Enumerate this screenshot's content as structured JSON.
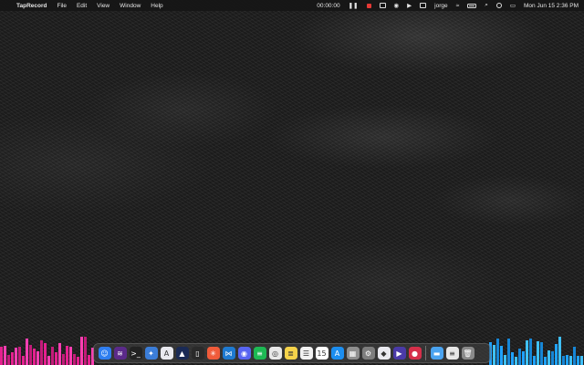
{
  "menubar": {
    "app_name": "TapRecord",
    "menus": [
      "File",
      "Edit",
      "View",
      "Window",
      "Help"
    ],
    "timer": "00:00:00",
    "user": "jorge",
    "datetime": "Mon Jun 15  2:36 PM",
    "record_color": "#e53935"
  },
  "dock": {
    "apps": [
      {
        "name": "finder",
        "glyph": "☺",
        "bg": "#2f7ef0"
      },
      {
        "name": "wave-app",
        "glyph": "≋",
        "bg": "#5b2a8a"
      },
      {
        "name": "terminal",
        "glyph": ">_",
        "bg": "#222222"
      },
      {
        "name": "xcode-like",
        "glyph": "✦",
        "bg": "#3b7dd8"
      },
      {
        "name": "arc",
        "glyph": "A",
        "bg": "#e9e9ef"
      },
      {
        "name": "anytype",
        "glyph": "▲",
        "bg": "#1a2a55"
      },
      {
        "name": "notes-dark",
        "glyph": "▯",
        "bg": "#2a2a2a"
      },
      {
        "name": "raycast",
        "glyph": "✳",
        "bg": "#f05b3a"
      },
      {
        "name": "vscode",
        "glyph": "⋈",
        "bg": "#1e7ad1"
      },
      {
        "name": "discord",
        "glyph": "◉",
        "bg": "#5865f2"
      },
      {
        "name": "spotify",
        "glyph": "≡",
        "bg": "#1db954"
      },
      {
        "name": "chrome",
        "glyph": "◎",
        "bg": "#e8e8e8"
      },
      {
        "name": "notes",
        "glyph": "≣",
        "bg": "#f6d34a"
      },
      {
        "name": "reminders",
        "glyph": "☰",
        "bg": "#f2f2f2"
      },
      {
        "name": "calendar",
        "glyph": "15",
        "bg": "#ffffff"
      },
      {
        "name": "app-store",
        "glyph": "A",
        "bg": "#1c8ef0"
      },
      {
        "name": "launchpad",
        "glyph": "▦",
        "bg": "#8f8f8f"
      },
      {
        "name": "system-settings",
        "glyph": "⚙",
        "bg": "#7d7d7d"
      },
      {
        "name": "roblox",
        "glyph": "◆",
        "bg": "#e9e9ef"
      },
      {
        "name": "beats",
        "glyph": "▶",
        "bg": "#4a3aa8"
      },
      {
        "name": "taprecord",
        "glyph": "●",
        "bg": "#d62f4a"
      }
    ],
    "right_items": [
      {
        "name": "folder",
        "glyph": "▬",
        "bg": "#4aa3f0"
      },
      {
        "name": "document",
        "glyph": "≡",
        "bg": "#e6e6e6"
      },
      {
        "name": "trash",
        "glyph": "🗑",
        "bg": "#8a8a8a"
      }
    ]
  }
}
